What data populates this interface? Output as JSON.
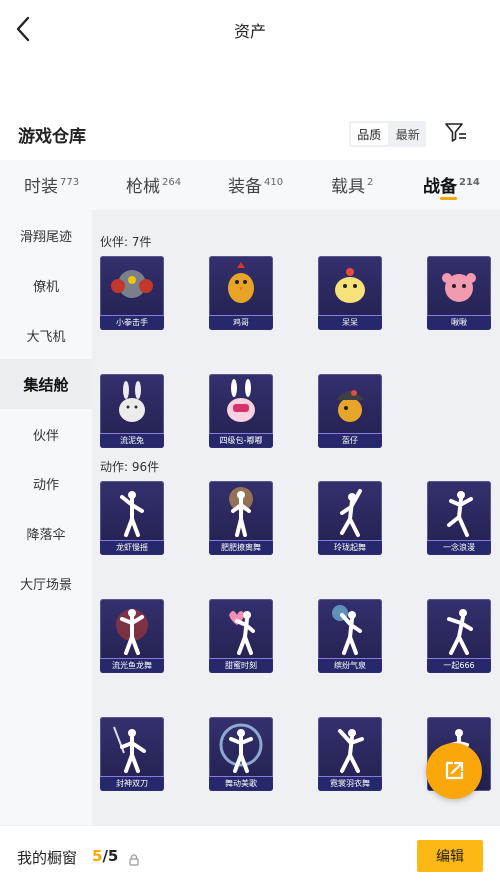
{
  "header": {
    "title": "资产"
  },
  "warehouse": {
    "title": "游戏仓库",
    "sort_options": [
      "品质",
      "最新"
    ]
  },
  "tabs": [
    {
      "label": "时装",
      "count": "773"
    },
    {
      "label": "枪械",
      "count": "264"
    },
    {
      "label": "装备",
      "count": "410"
    },
    {
      "label": "载具",
      "count": "2"
    },
    {
      "label": "战备",
      "count": "214"
    }
  ],
  "sidebar": {
    "items": [
      {
        "label": "滑翔尾迹"
      },
      {
        "label": "僚机"
      },
      {
        "label": "大飞机"
      },
      {
        "label": "集结舱"
      },
      {
        "label": "伙伴"
      },
      {
        "label": "动作"
      },
      {
        "label": "降落伞"
      },
      {
        "label": "大厅场景"
      }
    ]
  },
  "sections": {
    "partners": {
      "label": "伙伴: 7件",
      "items": [
        "小拳击手",
        "鸡哥",
        "呆呆",
        "啾啾",
        "流泥兔",
        "四级包-嘟嘟",
        "盔仔"
      ]
    },
    "actions": {
      "label": "动作: 96件",
      "items": [
        "龙虾慢摇",
        "肥肥撩离舞",
        "玲珑起舞",
        "一念浪漫",
        "流光鱼龙舞",
        "甜蜜时刻",
        "缤纷气泉",
        "一起666",
        "封神双刀",
        "舞动美歌",
        "霓裳羽衣舞"
      ]
    }
  },
  "showcase": {
    "label": "我的橱窗",
    "current": "5",
    "total": "/5",
    "edit_label": "编辑"
  },
  "colors": {
    "accent": "#f5a800",
    "card_bg": "#2a275c"
  }
}
